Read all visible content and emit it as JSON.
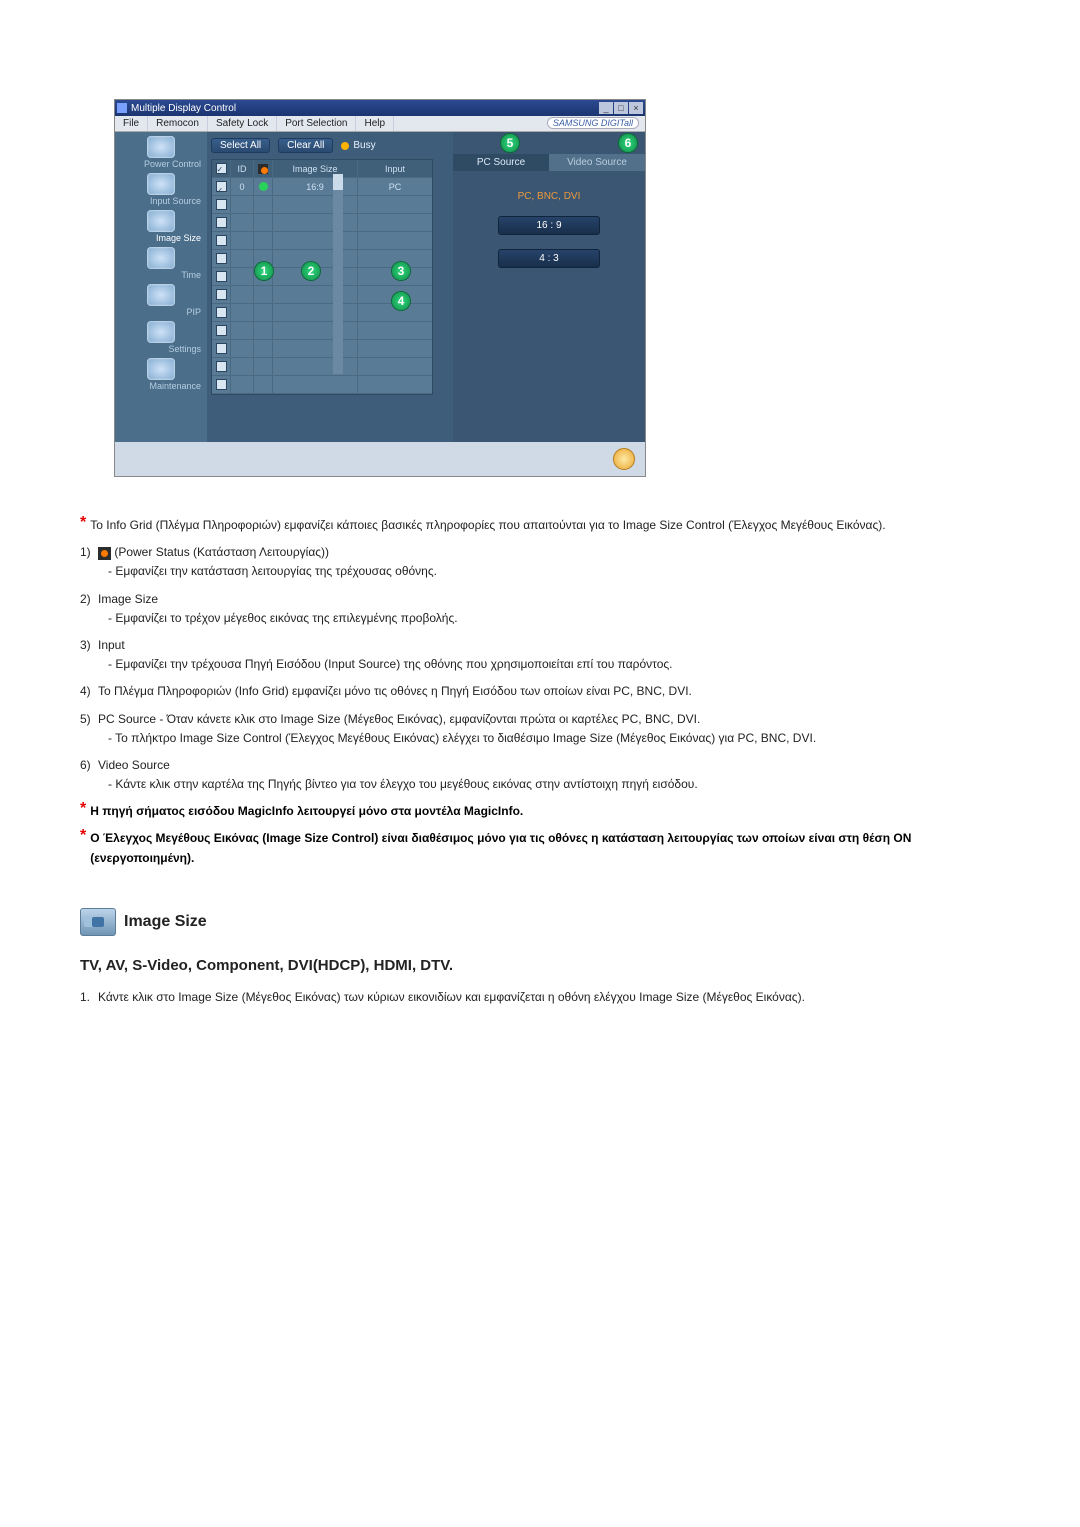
{
  "window": {
    "title": "Multiple Display Control"
  },
  "menu": {
    "file": "File",
    "remocon": "Remocon",
    "safety": "Safety Lock",
    "port": "Port Selection",
    "help": "Help",
    "brand": "SAMSUNG DIGITall"
  },
  "sidebar": {
    "items": [
      {
        "label": "Power Control"
      },
      {
        "label": "Input Source"
      },
      {
        "label": "Image Size"
      },
      {
        "label": "Time"
      },
      {
        "label": "PIP"
      },
      {
        "label": "Settings"
      },
      {
        "label": "Maintenance"
      }
    ]
  },
  "buttons": {
    "select_all": "Select All",
    "clear_all": "Clear All",
    "busy": "Busy"
  },
  "grid": {
    "head_id": "ID",
    "head_size": "Image Size",
    "head_input": "Input",
    "rows": [
      {
        "id": "0",
        "size": "16:9",
        "input": "PC",
        "checked": true,
        "on": true
      }
    ],
    "blank_rows": 11
  },
  "right_panel": {
    "tab_pc": "PC Source",
    "tab_video": "Video Source",
    "label": "PC, BNC, DVI",
    "opt1": "16 : 9",
    "opt2": "4 : 3"
  },
  "callouts": {
    "c1": "1",
    "c2": "2",
    "c3": "3",
    "c4": "4",
    "c5": "5",
    "c6": "6"
  },
  "doc": {
    "intro_star": "Το Info Grid (Πλέγμα Πληροφοριών) εμφανίζει κάποιες βασικές πληροφορίες που απαιτούνται για το Image Size Control (Έλεγχος Μεγέθους Εικόνας).",
    "i1_a": "(Power Status (Κατάσταση Λειτουργίας))",
    "i1_b": "- Εμφανίζει την κατάσταση λειτουργίας της τρέχουσας οθόνης.",
    "i2_h": "Image Size",
    "i2_b": "- Εμφανίζει το τρέχον μέγεθος εικόνας της επιλεγμένης προβολής.",
    "i3_h": "Input",
    "i3_b": "- Εμφανίζει την τρέχουσα Πηγή Εισόδου (Input Source) της οθόνης που χρησιμοποιείται επί του παρόντος.",
    "i4": "Το Πλέγμα Πληροφοριών (Info Grid) εμφανίζει μόνο τις οθόνες η Πηγή Εισόδου των οποίων είναι PC, BNC, DVI.",
    "i5_a": "PC Source - Όταν κάνετε κλικ στο Image Size (Μέγεθος Εικόνας), εμφανίζονται πρώτα οι καρτέλες PC, BNC, DVI.",
    "i5_b": "- Το πλήκτρο Image Size Control (Έλεγχος Μεγέθους Εικόνας) ελέγχει το διαθέσιμο Image Size (Μέγεθος Εικόνας) για PC, BNC, DVI.",
    "i6_h": "Video Source",
    "i6_b": "- Κάντε κλικ στην καρτέλα της Πηγής βίντεο για τον έλεγχο του μεγέθους εικόνας στην αντίστοιχη πηγή εισόδου.",
    "note1": "Η πηγή σήματος εισόδου MagicInfo λειτουργεί μόνο στα μοντέλα MagicInfo.",
    "note2": "Ο Έλεγχος Μεγέθους Εικόνας (Image Size Control) είναι διαθέσιμος μόνο για τις οθόνες η κατάσταση λειτουργίας των οποίων είναι στη θέση ON (ενεργοποιημένη).",
    "section_title": "Image Size",
    "h3": "TV, AV, S-Video, Component, DVI(HDCP), HDMI, DTV.",
    "last_num": "1.",
    "last": "Κάντε κλικ στο Image Size (Μέγεθος Εικόνας) των κύριων εικονιδίων και εμφανίζεται η οθόνη ελέγχου Image Size (Μέγεθος Εικόνας).",
    "n1": "1)",
    "n2": "2)",
    "n3": "3)",
    "n4": "4)",
    "n5": "5)",
    "n6": "6)"
  }
}
